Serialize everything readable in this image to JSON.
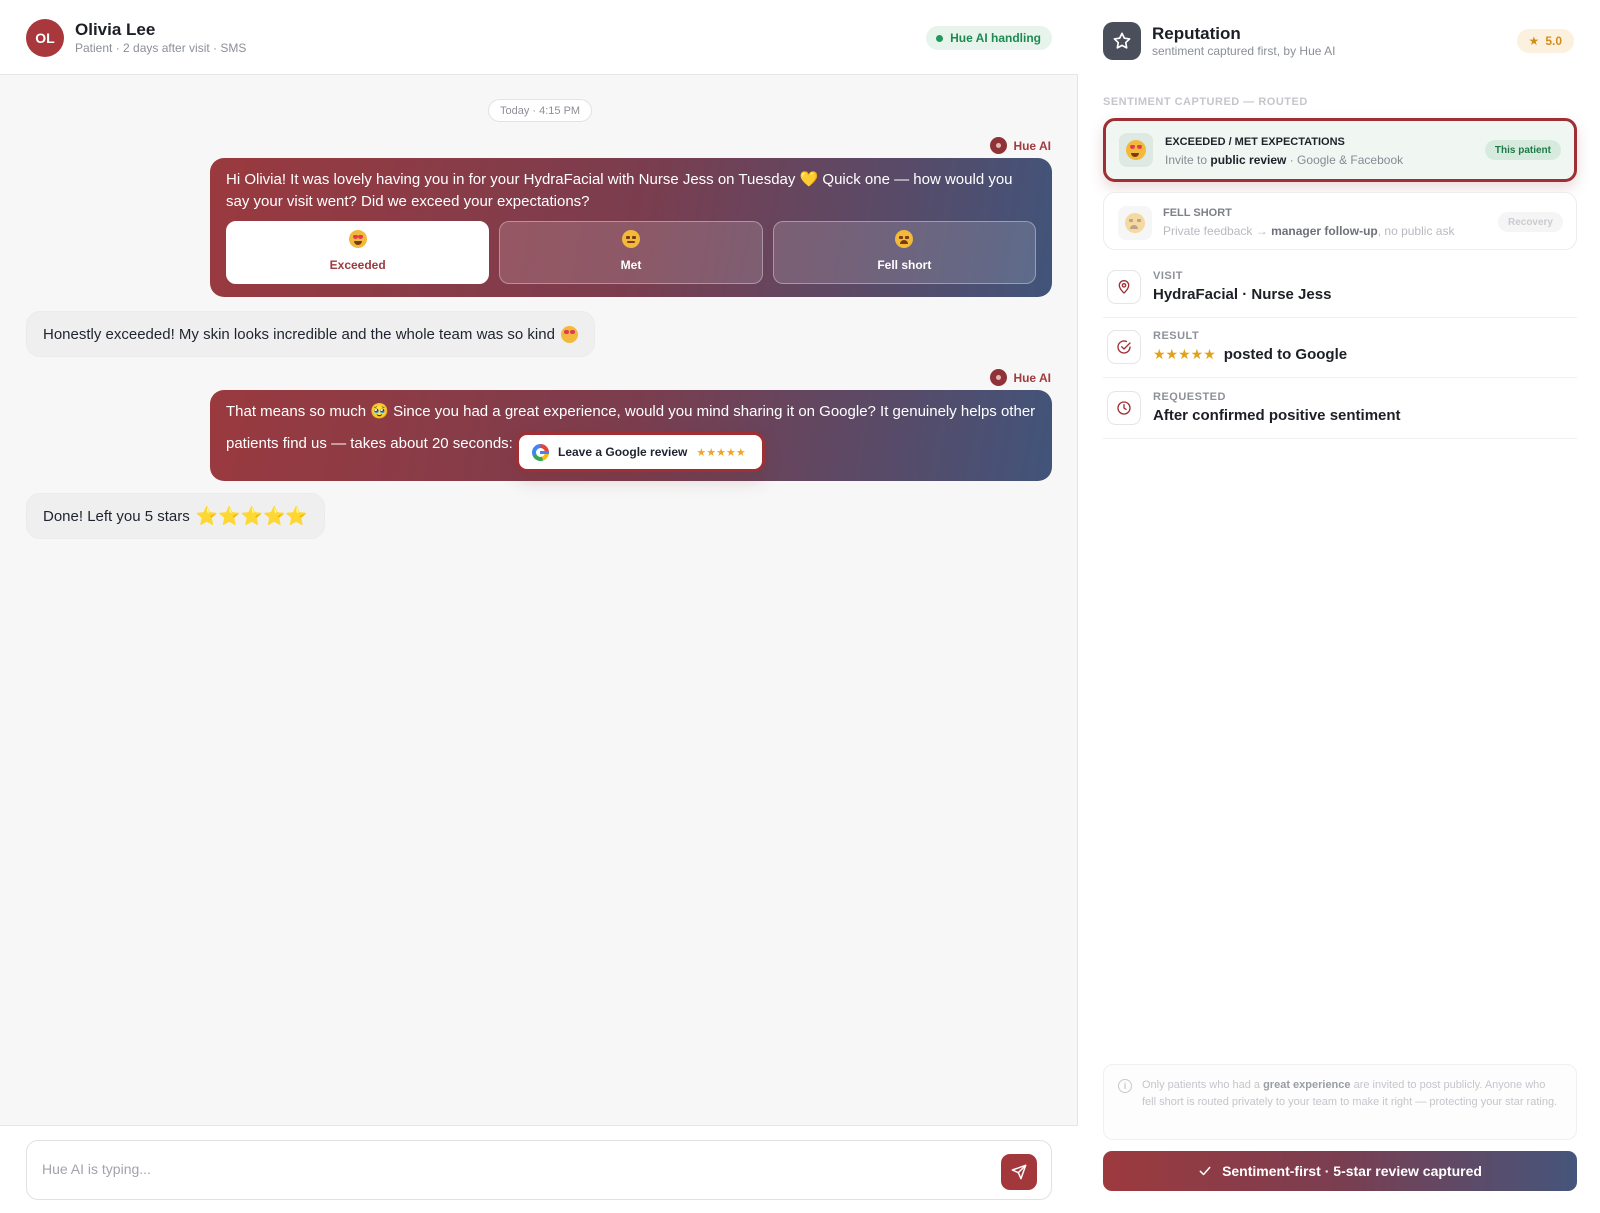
{
  "header": {
    "avatar_initials": "OL",
    "patient_name": "Olivia Lee",
    "patient_meta": "Patient · 2 days after visit · SMS",
    "status_pill": "Hue AI handling"
  },
  "chat": {
    "day_chip": "Today · 4:15 PM",
    "ai_sender": "Hue AI",
    "message1": "Hi Olivia! It was lovely having you in for your HydraFacial with Nurse Jess on Tuesday 💛 Quick one — how would you say your visit went? Did we exceed your expectations?",
    "choices": [
      {
        "label": "Exceeded",
        "emoji": "heart-eyes",
        "selected": true
      },
      {
        "label": "Met",
        "emoji": "neutral-face",
        "selected": false
      },
      {
        "label": "Fell short",
        "emoji": "sad-face",
        "selected": false
      }
    ],
    "reply1": "Honestly exceeded! My skin looks incredible and the whole team was so kind",
    "message2_part1": "That means so much 🥹 Since you had a great experience, would you mind sharing it on Google? It genuinely helps other",
    "message2_part2": "patients find us — takes about 20 seconds:",
    "review_button": "Leave a Google review",
    "review_stars": "★★★★★",
    "reply2": "Done! Left you 5 stars",
    "reply2_stars": "⭐⭐⭐⭐⭐",
    "composer_placeholder": "Hue AI is typing..."
  },
  "side": {
    "title": "Reputation",
    "subtitle": "sentiment captured first, by Hue AI",
    "rating": "5.0",
    "section_label": "SENTIMENT CAPTURED — ROUTED",
    "routes": [
      {
        "title": "EXCEEDED / MET EXPECTATIONS",
        "desc_pre": "Invite to ",
        "desc_bold": "public review",
        "desc_post": " · Google & Facebook",
        "tag": "This patient"
      },
      {
        "title": "FELL SHORT",
        "desc_pre": "Private feedback → ",
        "desc_bold": "manager follow-up",
        "desc_post": ", no public ask",
        "tag": "Recovery"
      }
    ],
    "info": [
      {
        "label": "VISIT",
        "value": "HydraFacial · Nurse Jess",
        "icon": "location-pin-icon"
      },
      {
        "label": "RESULT",
        "stars": "★★★★★",
        "value": "posted to Google",
        "icon": "check-circle-icon"
      },
      {
        "label": "REQUESTED",
        "value": "After confirmed positive sentiment",
        "icon": "clock-icon"
      }
    ],
    "note_pre": "Only patients who had a ",
    "note_bold": "great experience",
    "note_post": " are invited to post publicly. Anyone who fell short is routed privately to your team to make it right — protecting your star rating.",
    "cta": "Sentiment-first · 5-star review captured"
  },
  "colors": {
    "brand": "#a3383c",
    "gradient_end": "#45557b",
    "success": "#1e8a52",
    "star": "#f0a623"
  }
}
